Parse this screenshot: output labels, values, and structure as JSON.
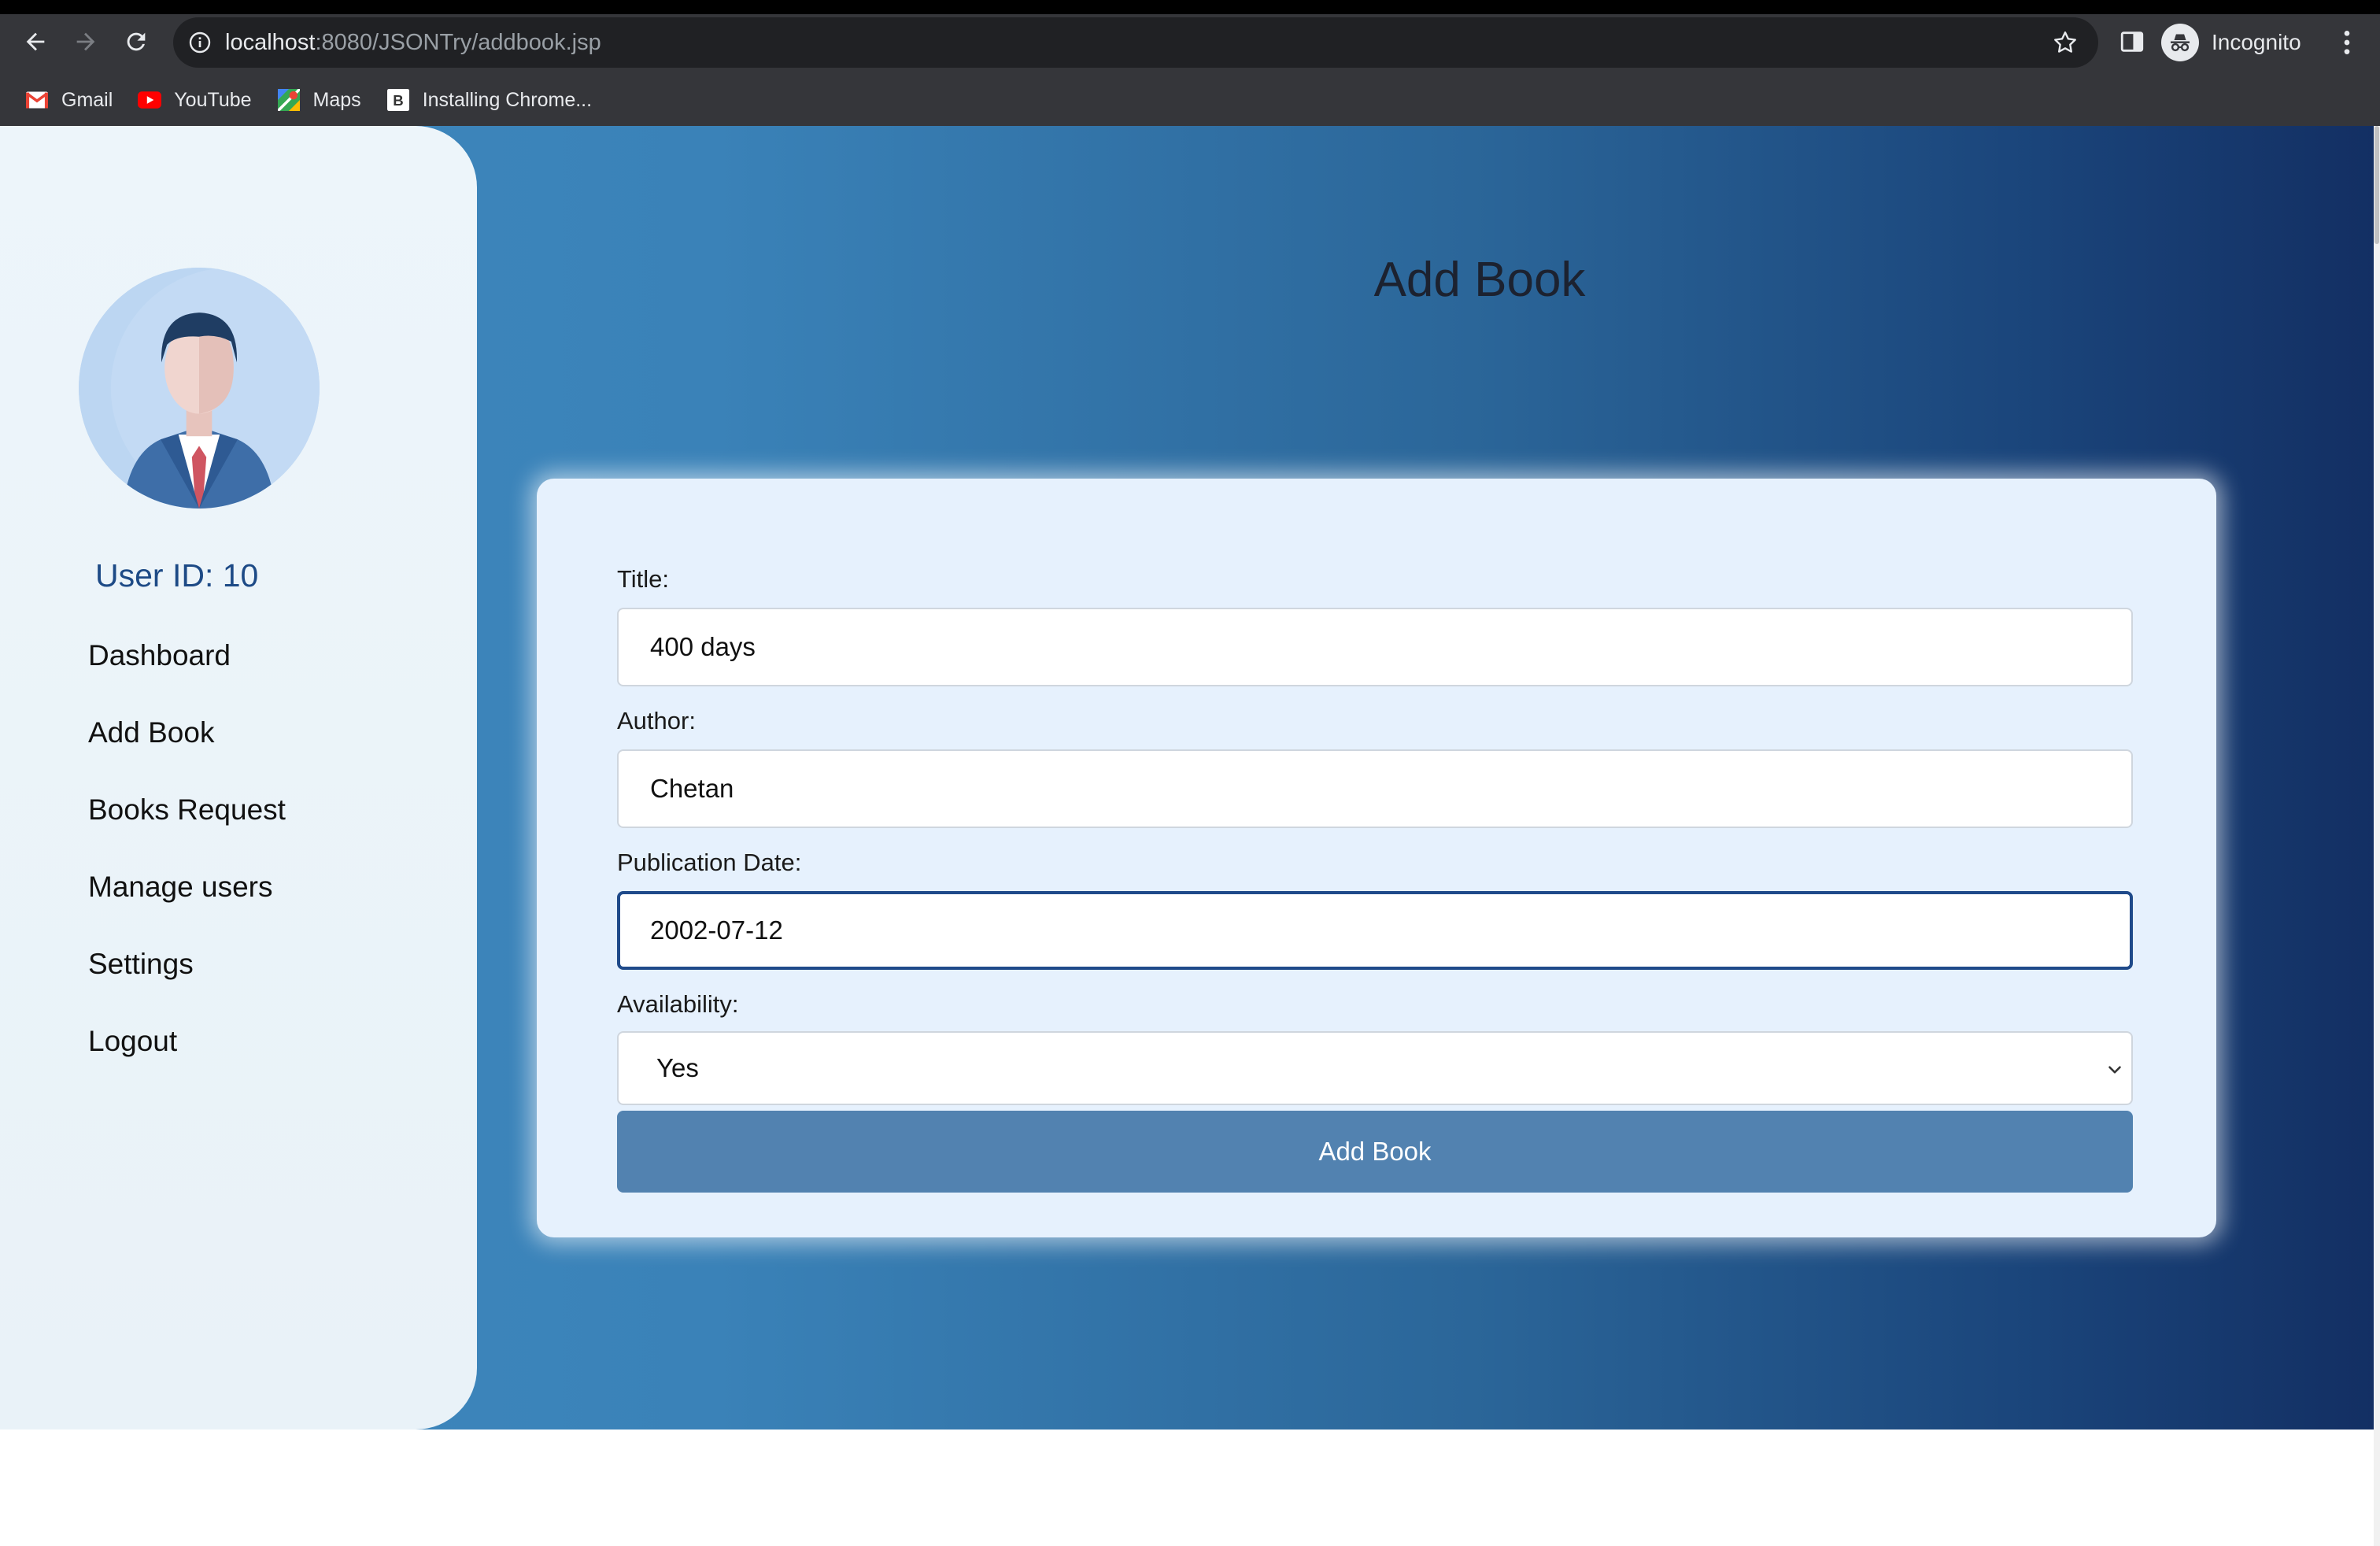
{
  "browser": {
    "url_host": "localhost",
    "url_path": ":8080/JSONTry/addbook.jsp",
    "profile_label": "Incognito",
    "bookmarks": [
      {
        "label": "Gmail",
        "icon": "gmail-icon"
      },
      {
        "label": "YouTube",
        "icon": "youtube-icon"
      },
      {
        "label": "Maps",
        "icon": "maps-icon"
      },
      {
        "label": "Installing Chrome...",
        "icon": "b-favicon"
      }
    ]
  },
  "sidebar": {
    "user_id": "User ID: 10",
    "items": [
      {
        "label": "Dashboard"
      },
      {
        "label": "Add Book"
      },
      {
        "label": "Books Request"
      },
      {
        "label": "Manage users"
      },
      {
        "label": "Settings"
      },
      {
        "label": "Logout"
      }
    ]
  },
  "main": {
    "title": "Add Book",
    "form": {
      "title_label": "Title:",
      "title_value": "400 days",
      "author_label": "Author:",
      "author_value": "Chetan",
      "pubdate_label": "Publication Date:",
      "pubdate_value": "2002-07-12",
      "availability_label": "Availability:",
      "availability_value": "Yes",
      "submit_label": "Add Book"
    }
  },
  "colors": {
    "sidebar_bg": "#edf5fa",
    "gradient_start": "#3f89bf",
    "gradient_end": "#132f63",
    "card_bg": "#e6f1fd",
    "button_bg": "#5282b0",
    "user_id_text": "#1d4a86",
    "focus_border": "#1f4a8a"
  }
}
